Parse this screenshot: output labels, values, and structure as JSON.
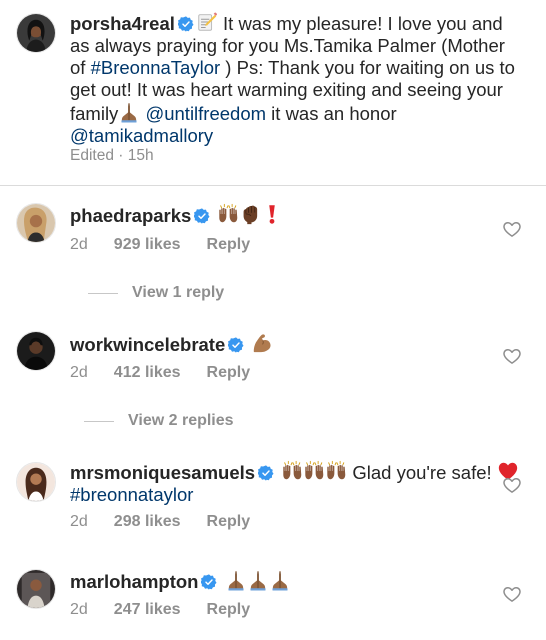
{
  "caption": {
    "username": "porsha4real",
    "text_1": " It was my pleasure! I love you and as always praying for you Ms.Tamika Palmer (Mother of ",
    "hashtag": "#BreonnaTaylor",
    "text_2": " ) Ps: Thank you for waiting on us to get out! It was heart warming exiting and seeing your family",
    "mention_1": "@untilfreedom",
    "text_3": " it was an honor ",
    "mention_2": "@tamikadmallory",
    "edited": "Edited · 15h"
  },
  "comments": [
    {
      "username": "phaedraparks",
      "time": "2d",
      "likes": "929 likes",
      "reply": "Reply",
      "view_replies": "View 1 reply"
    },
    {
      "username": "workwincelebrate",
      "time": "2d",
      "likes": "412 likes",
      "reply": "Reply",
      "view_replies": "View 2 replies"
    },
    {
      "username": "mrsmoniquesamuels",
      "text_1": " Glad you're safe! ",
      "hashtag": "#breonnataylor",
      "time": "2d",
      "likes": "298 likes",
      "reply": "Reply"
    },
    {
      "username": "marlohampton",
      "time": "2d",
      "likes": "247 likes",
      "reply": "Reply"
    }
  ],
  "icons": {
    "verified": "verified-badge-icon",
    "like": "heart-outline-icon",
    "memo": "memo-emoji",
    "praise": "raising-hands-emoji",
    "fist": "raised-fist-emoji",
    "exclamation": "red-exclamation-emoji",
    "flex": "flexed-biceps-emoji",
    "heart": "red-heart-emoji",
    "pray": "folded-hands-emoji"
  },
  "colors": {
    "verified_blue": "#3897f0",
    "hashtag_blue": "#00376b",
    "secondary_text": "#8e8e8e",
    "skin_tone": "#8a5a3c"
  }
}
